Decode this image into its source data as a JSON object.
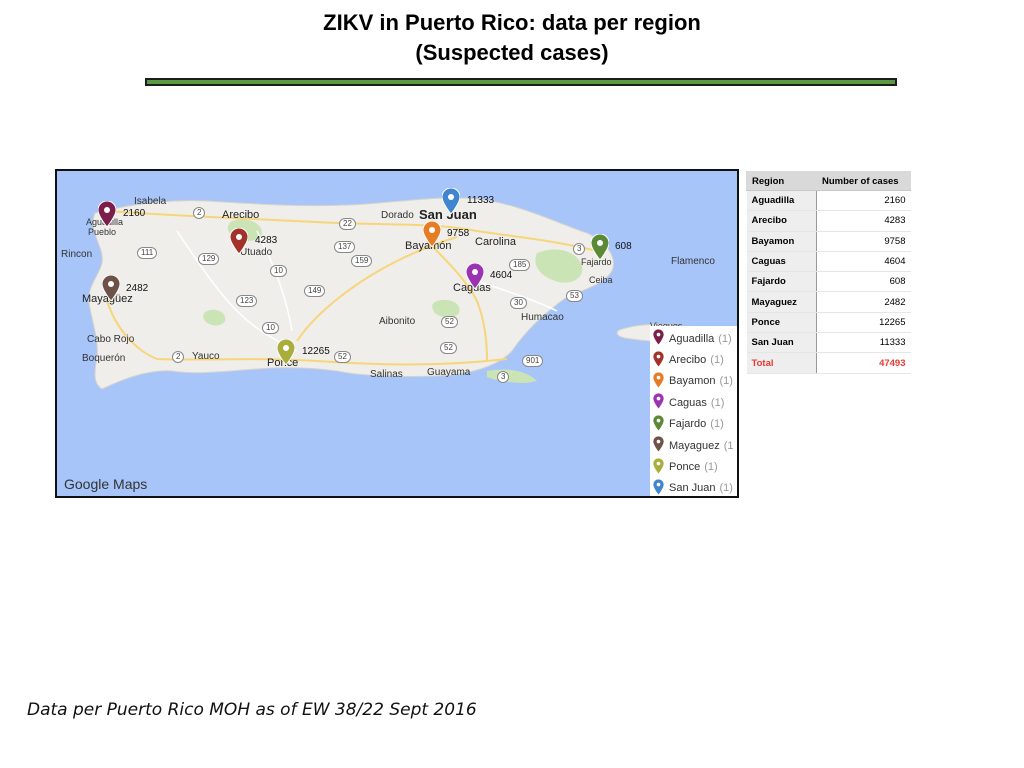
{
  "title": {
    "line1": "ZIKV in Puerto Rico: data per region",
    "line2": "(Suspected cases)"
  },
  "map": {
    "attribution": "Google Maps",
    "places": {
      "isabela": "Isabela",
      "aguadilla": "Aguadilla",
      "pueblo": "Pueblo",
      "arecibo": "Arecibo",
      "dorado": "Dorado",
      "san_juan": "San Juan",
      "bayamon": "Bayamón",
      "carolina": "Carolina",
      "fajardo": "Fajardo",
      "flamenco": "Flamenco",
      "ceiba": "Ceiba",
      "rincon": "Rincon",
      "mayaguez": "Mayagüez",
      "utuado": "Utuado",
      "caguas": "Caguas",
      "humacao": "Humacao",
      "aibonito": "Aibonito",
      "cabo_rojo": "Cabo Rojo",
      "boqueron": "Boquerón",
      "yauco": "Yauco",
      "ponce": "Ponce",
      "salinas": "Salinas",
      "guayama": "Guayama",
      "vieques": "Vieques"
    },
    "roads": {
      "r2a": "2",
      "r22": "22",
      "r137": "137",
      "r159": "159",
      "r3": "3",
      "r111": "111",
      "r129": "129",
      "r10a": "10",
      "r185": "185",
      "r149": "149",
      "r123": "123",
      "r52a": "52",
      "r53": "53",
      "r30": "30",
      "r10b": "10",
      "r2b": "2",
      "r52b": "52",
      "r52c": "52",
      "r901": "901",
      "r3b": "3"
    },
    "markers": [
      {
        "region": "Aguadilla",
        "value": "2160",
        "color": "#7b1f4a"
      },
      {
        "region": "Arecibo",
        "value": "4283",
        "color": "#a2322a"
      },
      {
        "region": "Bayamon",
        "value": "9758",
        "color": "#e77c27"
      },
      {
        "region": "Caguas",
        "value": "4604",
        "color": "#9b34b3"
      },
      {
        "region": "Fajardo",
        "value": "608",
        "color": "#5b8a36"
      },
      {
        "region": "Mayaguez",
        "value": "2482",
        "color": "#6e5247"
      },
      {
        "region": "Ponce",
        "value": "12265",
        "color": "#a9ad3c"
      },
      {
        "region": "San Juan",
        "value": "11333",
        "color": "#3f85cf"
      }
    ],
    "legend": [
      {
        "label": "Aguadilla",
        "count": "(1)",
        "color": "#7b1f4a"
      },
      {
        "label": "Arecibo",
        "count": "(1)",
        "color": "#a2322a"
      },
      {
        "label": "Bayamon",
        "count": "(1)",
        "color": "#e77c27"
      },
      {
        "label": "Caguas",
        "count": "(1)",
        "color": "#9b34b3"
      },
      {
        "label": "Fajardo",
        "count": "(1)",
        "color": "#5b8a36"
      },
      {
        "label": "Mayaguez",
        "count": "(1",
        "color": "#6e5247"
      },
      {
        "label": "Ponce",
        "count": "(1)",
        "color": "#a9ad3c"
      },
      {
        "label": "San Juan",
        "count": "(1)",
        "color": "#3f85cf"
      }
    ]
  },
  "table": {
    "headers": [
      "Region",
      "Number of cases"
    ],
    "rows": [
      [
        "Aguadilla",
        "2160"
      ],
      [
        "Arecibo",
        "4283"
      ],
      [
        "Bayamon",
        "9758"
      ],
      [
        "Caguas",
        "4604"
      ],
      [
        "Fajardo",
        "608"
      ],
      [
        "Mayaguez",
        "2482"
      ],
      [
        "Ponce",
        "12265"
      ],
      [
        "San Juan",
        "11333"
      ]
    ],
    "total_label": "Total",
    "total_value": "47493",
    "total_color": "#e53935"
  },
  "footnote": "Data per Puerto Rico MOH as of EW 38/22 Sept 2016"
}
